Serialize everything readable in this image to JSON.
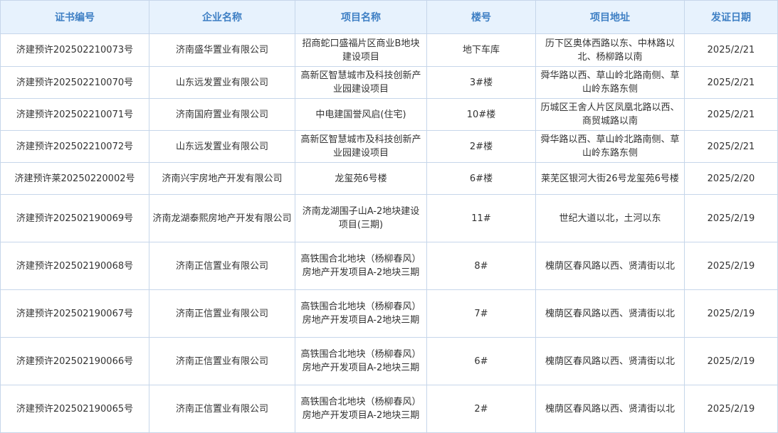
{
  "table": {
    "headers": [
      "证书编号",
      "企业名称",
      "项目名称",
      "楼号",
      "项目地址",
      "发证日期"
    ],
    "rows": [
      {
        "cert_no": "济建预许202502210073号",
        "company": "济南盛华置业有限公司",
        "project": "招商蛇口盛福片区商业B地块建设项目",
        "building": "地下车库",
        "address": "历下区奥体西路以东、中林路以北、杨柳路以南",
        "issue_date": "2025/2/21"
      },
      {
        "cert_no": "济建预许202502210070号",
        "company": "山东远发置业有限公司",
        "project": "高新区智慧城市及科技创新产业园建设项目",
        "building": "3#楼",
        "address": "舜华路以西、草山岭北路南侧、草山岭东路东侧",
        "issue_date": "2025/2/21"
      },
      {
        "cert_no": "济建预许202502210071号",
        "company": "济南国府置业有限公司",
        "project": "中电建国誉风启(住宅)",
        "building": "10#楼",
        "address": "历城区王舍人片区凤凰北路以西、商贸城路以南",
        "issue_date": "2025/2/21"
      },
      {
        "cert_no": "济建预许202502210072号",
        "company": "山东远发置业有限公司",
        "project": "高新区智慧城市及科技创新产业园建设项目",
        "building": "2#楼",
        "address": "舜华路以西、草山岭北路南侧、草山岭东路东侧",
        "issue_date": "2025/2/21"
      },
      {
        "cert_no": "济建预许莱20250220002号",
        "company": "济南兴宇房地产开发有限公司",
        "project": "龙玺苑6号楼",
        "building": "6#楼",
        "address": "莱芜区银河大街26号龙玺苑6号楼",
        "issue_date": "2025/2/20"
      },
      {
        "cert_no": "济建预许202502190069号",
        "company": "济南龙湖泰熙房地产开发有限公司",
        "project": "济南龙湖围子山A-2地块建设项目(三期)",
        "building": "11#",
        "address": "世纪大道以北，土河以东",
        "issue_date": "2025/2/19"
      },
      {
        "cert_no": "济建预许202502190068号",
        "company": "济南正信置业有限公司",
        "project": "高铁围合北地块（杨柳春风）房地产开发项目A-2地块三期",
        "building": "8#",
        "address": "槐荫区春风路以西、贤清街以北",
        "issue_date": "2025/2/19"
      },
      {
        "cert_no": "济建预许202502190067号",
        "company": "济南正信置业有限公司",
        "project": "高铁围合北地块（杨柳春风）房地产开发项目A-2地块三期",
        "building": "7#",
        "address": "槐荫区春风路以西、贤清街以北",
        "issue_date": "2025/2/19"
      },
      {
        "cert_no": "济建预许202502190066号",
        "company": "济南正信置业有限公司",
        "project": "高铁围合北地块（杨柳春风）房地产开发项目A-2地块三期",
        "building": "6#",
        "address": "槐荫区春风路以西、贤清街以北",
        "issue_date": "2025/2/19"
      },
      {
        "cert_no": "济建预许202502190065号",
        "company": "济南正信置业有限公司",
        "project": "高铁围合北地块（杨柳春风）房地产开发项目A-2地块三期",
        "building": "2#",
        "address": "槐荫区春风路以西、贤清街以北",
        "issue_date": "2025/2/19"
      }
    ]
  }
}
